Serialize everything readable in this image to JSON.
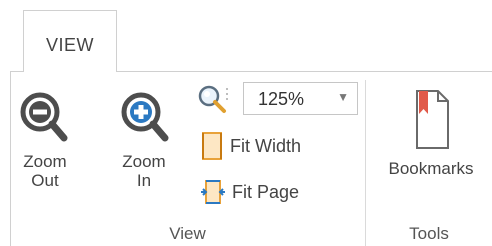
{
  "ribbon": {
    "active_tab": "VIEW",
    "groups": {
      "view": {
        "label": "View",
        "zoom_out": {
          "line1": "Zoom",
          "line2": "Out"
        },
        "zoom_in": {
          "line1": "Zoom",
          "line2": "In"
        },
        "zoom_level": "125%",
        "fit_width": "Fit Width",
        "fit_page": "Fit Page"
      },
      "tools": {
        "label": "Tools",
        "bookmarks": "Bookmarks"
      }
    },
    "icons": {
      "zoom_out": "magnifier-minus-icon",
      "zoom_in": "magnifier-plus-icon",
      "zoom_level": "magnifier-icon",
      "fit_width": "fit-width-icon",
      "fit_page": "fit-page-icon",
      "bookmarks": "bookmark-icon",
      "dropdown": "chevron-down-icon"
    },
    "colors": {
      "magnifier": "#4d4d4d",
      "zoom_accent": "#2b79c2",
      "fit_orange": "#e8a23a",
      "bookmark_red": "#e15a4a"
    }
  }
}
